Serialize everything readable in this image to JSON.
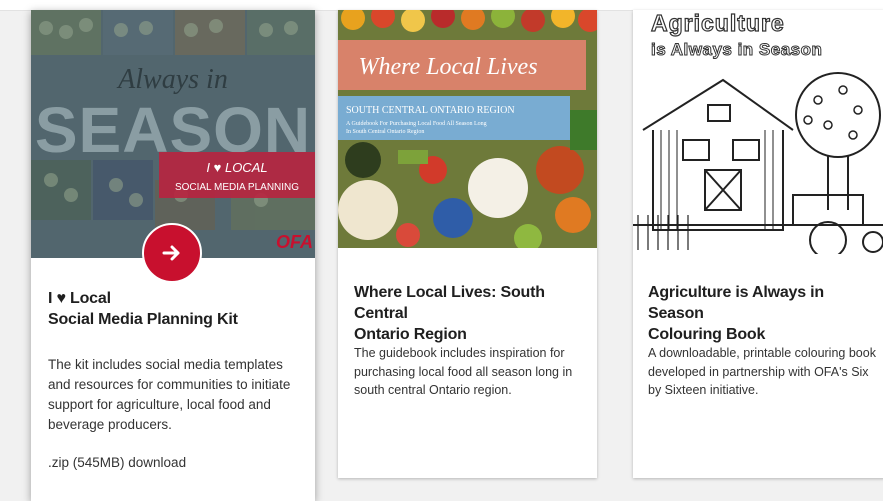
{
  "cards": [
    {
      "image": {
        "script_text": "Always in",
        "big_text": "SEASON",
        "badge_line1": "I ♥ LOCAL",
        "badge_line2": "SOCIAL MEDIA PLANNING",
        "logo_text": "OFA"
      },
      "title_line1": "I ♥ Local",
      "title_line2": "Social Media Planning Kit",
      "description": "The kit includes social media templates and resources for communities to initiate support for agriculture, local food and beverage producers.",
      "download": ".zip (545MB) download",
      "arrow_icon": "arrow-right-icon"
    },
    {
      "image": {
        "banner_text": "Where Local Lives",
        "region_text": "SOUTH CENTRAL ONTARIO REGION",
        "sub_text_line1": "A Guidebook For Purchasing Local Food All Season Long",
        "sub_text_line2": "In South Central Ontario Region"
      },
      "title_line1": "Where Local Lives: South Central",
      "title_line2": "Ontario Region",
      "description": "The guidebook includes inspiration for purchasing local food all season long in south central Ontario region."
    },
    {
      "image": {
        "line1": "Agriculture",
        "line2": "is Always in Season"
      },
      "title_line1": "Agriculture is Always in Season",
      "title_line2": "Colouring Book",
      "description": "A downloadable, printable colouring book developed in partnership with OFA's Six by Sixteen initiative."
    }
  ],
  "colors": {
    "accent_red": "#c8102e",
    "overlay": "#52666e",
    "banner_salmon": "#d87a5c",
    "region_blue": "#6fa3c9"
  }
}
